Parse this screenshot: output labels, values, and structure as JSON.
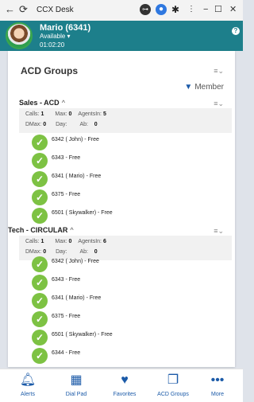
{
  "window": {
    "title": "CCX Desk",
    "minimize": "−",
    "maximize": "☐",
    "close": "✕",
    "back": "←",
    "reload": "⟳"
  },
  "header": {
    "name": "Mario (6341)",
    "status": "Available ▾",
    "timer": "01:02:20",
    "help": "?"
  },
  "panel": {
    "title": "ACD Groups",
    "member_filter_label": "Member"
  },
  "groups": [
    {
      "name": "Sales - ACD",
      "chevron": "^",
      "stats": {
        "calls_label": "Calls:",
        "calls": "1",
        "max_label": "Max:",
        "max": "0",
        "agents_label": "AgentsIn:",
        "agents": "5",
        "dmax_label": "DMax:",
        "dmax": "0",
        "day_label": "Day:",
        "ab_label": "Ab:",
        "ab": "0"
      },
      "members": [
        "6342 ( John)  -  Free",
        "6343  -  Free",
        "6341 ( Mario)  -  Free",
        "6375  -  Free",
        "6501 ( Skywalker)  -  Free"
      ]
    },
    {
      "name": "Tech - CIRCULAR",
      "chevron": "^",
      "stats": {
        "calls_label": "Calls:",
        "calls": "1",
        "max_label": "Max:",
        "max": "0",
        "agents_label": "AgentsIn:",
        "agents": "6",
        "dmax_label": "DMax:",
        "dmax": "0",
        "day_label": "Day:",
        "ab_label": "Ab:",
        "ab": "0"
      },
      "members": [
        "6342 ( John)  -  Free",
        "6343  -  Free",
        "6341 ( Mario)  -  Free",
        "6375  -  Free",
        "6501 ( Skywalker)  -  Free",
        "6344  -  Free"
      ]
    }
  ],
  "nav": [
    {
      "label": "Alerts",
      "icon": "bell-icon"
    },
    {
      "label": "Dial Pad",
      "icon": "dialpad-icon"
    },
    {
      "label": "Favorites",
      "icon": "heart-icon"
    },
    {
      "label": "ACD Groups",
      "icon": "acd-groups-icon"
    },
    {
      "label": "More",
      "icon": "more-icon"
    }
  ],
  "colors": {
    "header": "#1d7f8b",
    "accent": "#1b5aa8",
    "status_free": "#7dc243"
  }
}
